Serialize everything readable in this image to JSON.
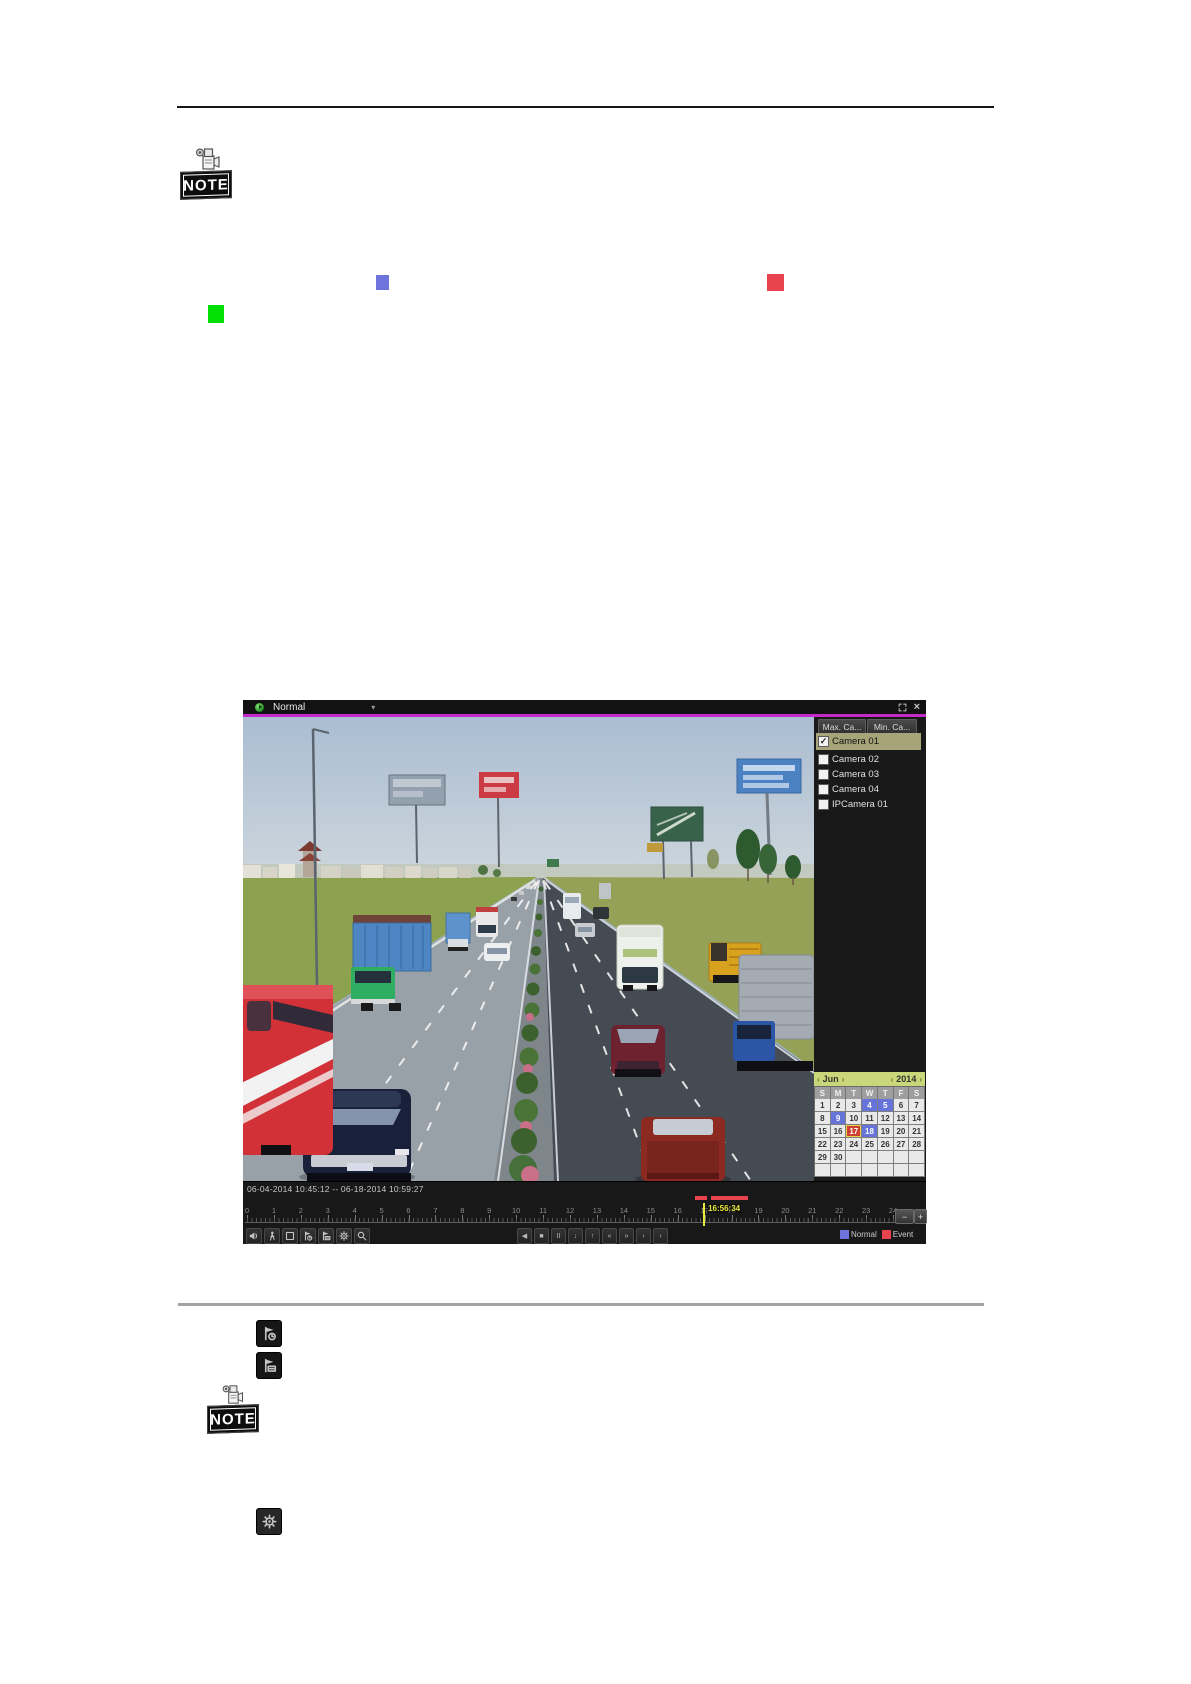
{
  "labels": {
    "note": "NOTE"
  },
  "inline_markers": [
    {
      "name": "record-type-normal-color",
      "color": "#6f74dd"
    },
    {
      "name": "record-type-event-color",
      "color": "#e8434e"
    },
    {
      "name": "record-type-exception-color",
      "color": "#02df02"
    }
  ],
  "player": {
    "topbar": {
      "mode": "Normal",
      "caret": "▾",
      "close_glyph": "×"
    },
    "side": {
      "buttons": [
        {
          "label": "Max. Ca..."
        },
        {
          "label": "Min. Ca..."
        }
      ],
      "cameras": [
        {
          "label": "Camera 01",
          "checked": true,
          "selected": true
        },
        {
          "label": "Camera 02",
          "checked": false,
          "selected": false
        },
        {
          "label": "Camera 03",
          "checked": false,
          "selected": false
        },
        {
          "label": "Camera 04",
          "checked": false,
          "selected": false
        },
        {
          "label": "IPCamera 01",
          "checked": false,
          "selected": false
        }
      ],
      "calendar": {
        "month": "Jun",
        "year": "2014",
        "nav_prev": "‹",
        "nav_next": "›",
        "day_headers": [
          "S",
          "M",
          "T",
          "W",
          "T",
          "F",
          "S"
        ],
        "weeks": [
          [
            "1",
            "2",
            "3",
            "4",
            "5",
            "6",
            "7"
          ],
          [
            "8",
            "9",
            "10",
            "11",
            "12",
            "13",
            "14"
          ],
          [
            "15",
            "16",
            "17",
            "18",
            "19",
            "20",
            "21"
          ],
          [
            "22",
            "23",
            "24",
            "25",
            "26",
            "27",
            "28"
          ],
          [
            "29",
            "30",
            "",
            "",
            "",
            "",
            ""
          ],
          [
            "",
            "",
            "",
            "",
            "",
            "",
            ""
          ]
        ],
        "record_days": [
          4,
          5,
          9,
          18
        ],
        "selected_day": 17,
        "colors": {
          "record": "#6673d9",
          "selected": "#cd4031",
          "selected_border": "#ead34a"
        }
      }
    },
    "status_text": "06-04-2014 10:45:12 -- 06-18-2014 10:59:27",
    "timeline": {
      "hour_labels": [
        "0",
        "1",
        "2",
        "3",
        "4",
        "5",
        "6",
        "7",
        "8",
        "9",
        "10",
        "11",
        "12",
        "13",
        "14",
        "15",
        "16",
        "17",
        "18",
        "19",
        "20",
        "21",
        "22",
        "23",
        "24"
      ],
      "playhead_time": "16:56:34",
      "event_segments": [
        {
          "start_hour": 16.65,
          "end_hour": 17.1
        },
        {
          "start_hour": 17.25,
          "end_hour": 18.6
        }
      ],
      "zoom_buttons": [
        {
          "name": "timeline-zoom-out-button",
          "glyph": "−"
        },
        {
          "name": "timeline-zoom-in-button",
          "glyph": "+"
        }
      ],
      "legend": [
        {
          "label": "Normal",
          "color": "#6f74dd"
        },
        {
          "label": "Event",
          "color": "#e8434e"
        }
      ]
    },
    "controls": {
      "left": [
        {
          "name": "audio-on-button",
          "icon": "speaker"
        },
        {
          "name": "smart-search-button",
          "icon": "person"
        },
        {
          "name": "draw-quadrilateral-button",
          "icon": "square"
        },
        {
          "name": "clip-start-button",
          "icon": "flag-clock"
        },
        {
          "name": "clip-end-button",
          "icon": "flag-box"
        },
        {
          "name": "file-management-button",
          "icon": "gear"
        },
        {
          "name": "digital-zoom-button",
          "icon": "magnifier"
        }
      ],
      "right": [
        {
          "name": "reverse-play-button",
          "glyph": "◀"
        },
        {
          "name": "stop-button",
          "glyph": "■"
        },
        {
          "name": "pause-button",
          "glyph": "II"
        },
        {
          "name": "thirty-sec-back-button",
          "glyph": "↓"
        },
        {
          "name": "thirty-sec-forward-button",
          "glyph": "↑"
        },
        {
          "name": "slow-down-button",
          "glyph": "«"
        },
        {
          "name": "speed-up-button",
          "glyph": "»"
        },
        {
          "name": "previous-file-button",
          "glyph": "‹"
        },
        {
          "name": "next-file-button",
          "glyph": "›"
        }
      ]
    }
  },
  "doc_icons": [
    {
      "name": "clip-start-icon",
      "icon": "flag-clock"
    },
    {
      "name": "clip-end-icon",
      "icon": "flag-box"
    },
    {
      "name": "settings-gear-icon",
      "icon": "gear"
    }
  ]
}
